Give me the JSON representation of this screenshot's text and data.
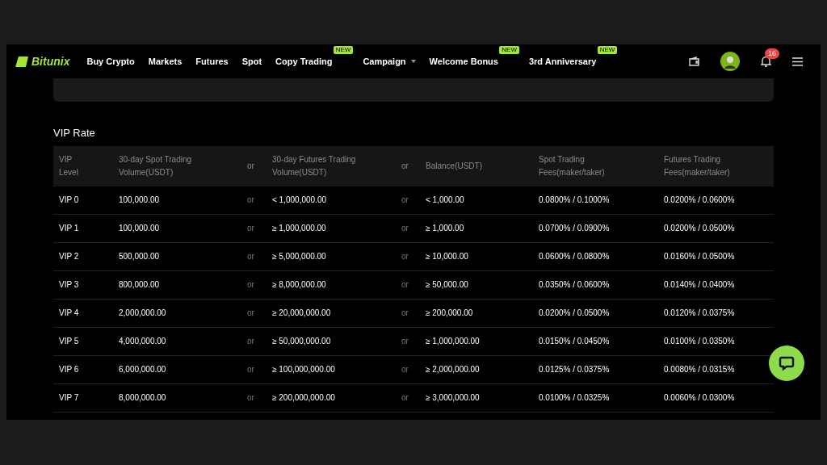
{
  "brand": "Bitunix",
  "nav": [
    {
      "label": "Buy Crypto"
    },
    {
      "label": "Markets"
    },
    {
      "label": "Futures"
    },
    {
      "label": "Spot"
    },
    {
      "label": "Copy Trading",
      "badge": "NEW"
    },
    {
      "label": "Campaign",
      "dropdown": true
    },
    {
      "label": "Welcome Bonus",
      "badge": "NEW"
    },
    {
      "label": "3rd Anniversary",
      "badge": "NEW"
    }
  ],
  "notifications": "16",
  "section_title": "VIP Rate",
  "table": {
    "columns": [
      "VIP\nLevel",
      "30-day Spot Trading\nVolume(USDT)",
      "or",
      "30-day Futures Trading\nVolume(USDT)",
      "or",
      "Balance(USDT)",
      "Spot Trading\nFees(maker/taker)",
      "Futures Trading\nFees(maker/taker)"
    ],
    "rows": [
      [
        "VIP 0",
        "100,000.00",
        "or",
        "< 1,000,000.00",
        "or",
        "< 1,000.00",
        "0.0800% / 0.1000%",
        "0.0200% / 0.0600%"
      ],
      [
        "VIP 1",
        "100,000.00",
        "or",
        "≥ 1,000,000.00",
        "or",
        "≥ 1,000.00",
        "0.0700% / 0.0900%",
        "0.0200% / 0.0500%"
      ],
      [
        "VIP 2",
        "500,000.00",
        "or",
        "≥ 5,000,000.00",
        "or",
        "≥ 10,000.00",
        "0.0600% / 0.0800%",
        "0.0160% / 0.0500%"
      ],
      [
        "VIP 3",
        "800,000.00",
        "or",
        "≥ 8,000,000.00",
        "or",
        "≥ 50,000.00",
        "0.0350% / 0.0600%",
        "0.0140% / 0.0400%"
      ],
      [
        "VIP 4",
        "2,000,000.00",
        "or",
        "≥ 20,000,000.00",
        "or",
        "≥ 200,000.00",
        "0.0200% / 0.0500%",
        "0.0120% / 0.0375%"
      ],
      [
        "VIP 5",
        "4,000,000.00",
        "or",
        "≥ 50,000,000.00",
        "or",
        "≥ 1,000,000.00",
        "0.0150% / 0.0450%",
        "0.0100% / 0.0350%"
      ],
      [
        "VIP 6",
        "6,000,000.00",
        "or",
        "≥ 100,000,000.00",
        "or",
        "≥ 2,000,000.00",
        "0.0125% / 0.0375%",
        "0.0080% / 0.0315%"
      ],
      [
        "VIP 7",
        "8,000,000.00",
        "or",
        "≥ 200,000,000.00",
        "or",
        "≥ 3,000,000.00",
        "0.0100% / 0.0325%",
        "0.0060% / 0.0300%"
      ]
    ]
  }
}
